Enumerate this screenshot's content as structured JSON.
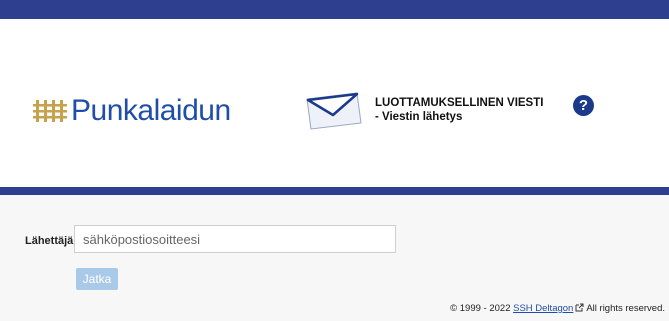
{
  "top_bar_color": "#2e3f8f",
  "logo": {
    "text": "Punkalaidun",
    "icon": "wooden-fence-icon",
    "text_color": "#1f4ea8",
    "icon_color": "#c8a24a"
  },
  "message": {
    "icon": "envelope-icon",
    "title_line1": "LUOTTAMUKSELLINEN VIESTI",
    "title_line2": "- Viestin lähetys"
  },
  "help": {
    "label": "?",
    "icon": "help-icon",
    "color": "#1b3a8c"
  },
  "form": {
    "sender_label": "Lähettäjä",
    "email_placeholder": "sähköpostiosoitteesi",
    "email_value": "",
    "continue_label": "Jatka",
    "continue_color": "#a9c9e8"
  },
  "footer": {
    "copyright_prefix": "© 1999 - 2022",
    "link_text": "SSH Deltagon",
    "link_icon": "external-link-icon",
    "suffix": "All rights reserved."
  }
}
